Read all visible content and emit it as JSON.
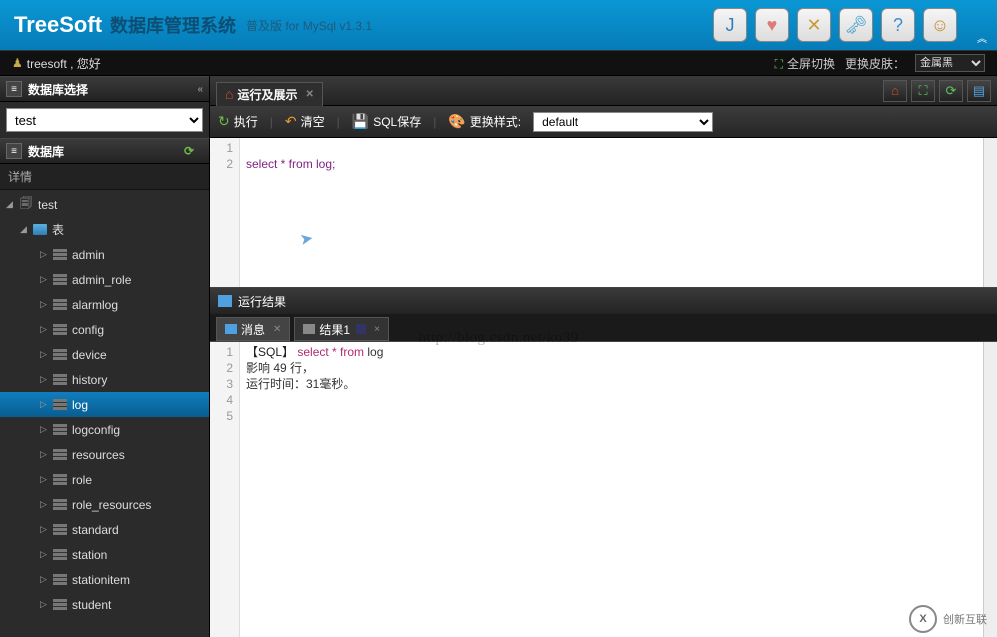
{
  "header": {
    "brand": "TreeSoft",
    "subtitle": "数据库管理系统",
    "version": "普及版 for MySql v1.3.1"
  },
  "topbar": {
    "greeting_user": "treesoft , 您好",
    "fullscreen": "全屏切换",
    "skin_label": "更换皮肤：",
    "skin_value": "金属黑"
  },
  "sidebar": {
    "sel_title": "数据库选择",
    "db_value": "test",
    "db_title": "数据库",
    "detail": "详情",
    "tree": {
      "root": "test",
      "tables_label": "表",
      "items": [
        "admin",
        "admin_role",
        "alarmlog",
        "config",
        "device",
        "history",
        "log",
        "logconfig",
        "resources",
        "role",
        "role_resources",
        "standard",
        "station",
        "stationitem",
        "student"
      ],
      "active": "log"
    }
  },
  "main": {
    "tab_label": "运行及展示",
    "toolbar": {
      "run": "执行",
      "clear": "清空",
      "save": "SQL保存",
      "style": "更换样式:",
      "style_value": "default"
    },
    "editor": {
      "lines": [
        "1",
        "2"
      ],
      "code_plain": "",
      "code_sql": "select * from log;"
    },
    "results": {
      "title": "运行结果",
      "tab_msg": "消息",
      "tab_res": "结果1",
      "lines": [
        "1",
        "2",
        "3",
        "4",
        "5"
      ],
      "l1_prefix": "【SQL】",
      "l1_kw": "select * from",
      "l1_rest": " log",
      "l2": "影响 49 行，",
      "l3": "运行时间：31毫秒。"
    }
  },
  "watermark": "http://blog.csdn.net/ko39",
  "logo_text": "创新互联"
}
